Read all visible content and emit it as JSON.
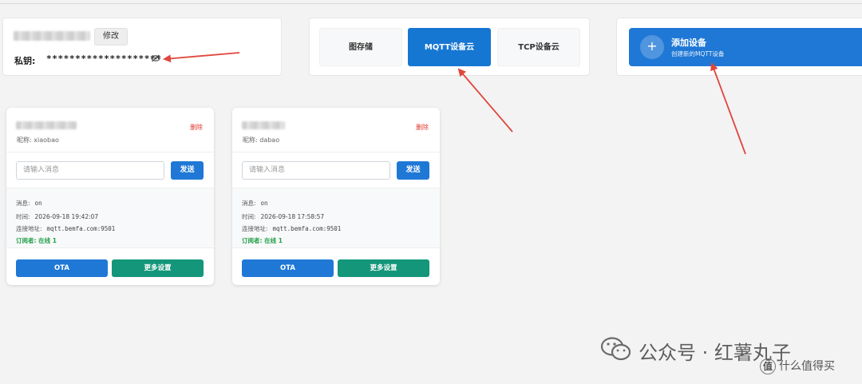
{
  "key_panel": {
    "edit_label": "修改",
    "key_label": "私钥:",
    "key_value": "********************"
  },
  "tabs": [
    {
      "label": "图存储",
      "active": false
    },
    {
      "label": "MQTT设备云",
      "active": true
    },
    {
      "label": "TCP设备云",
      "active": false
    }
  ],
  "add_device": {
    "icon": "+",
    "title": "添加设备",
    "subtitle": "创建新的MQTT设备"
  },
  "devices": [
    {
      "delete_label": "删除",
      "nickname": "昵称: xiaobao",
      "input_placeholder": "请输入消息",
      "send_label": "发送",
      "msg_label": "消息:",
      "msg_value": "on",
      "time_label": "时间:",
      "time_value": "2026-09-18 19:42:07",
      "addr_label": "连接地址:",
      "addr_value": "mqtt.bemfa.com:9501",
      "subscriber": "订阅者: 在线 1",
      "ota_label": "OTA",
      "more_label": "更多设置"
    },
    {
      "delete_label": "删除",
      "nickname": "昵称: dabao",
      "input_placeholder": "请输入消息",
      "send_label": "发送",
      "msg_label": "消息:",
      "msg_value": "on",
      "time_label": "时间:",
      "time_value": "2026-09-18 17:58:57",
      "addr_label": "连接地址:",
      "addr_value": "mqtt.bemfa.com:9501",
      "subscriber": "订阅者: 在线 1",
      "ota_label": "OTA",
      "more_label": "更多设置"
    }
  ],
  "watermark": {
    "text": "公众号 · 红薯丸子",
    "site_badge": "值",
    "site_text": "什么值得买"
  },
  "colors": {
    "primary": "#1f78d6",
    "teal": "#139679",
    "danger": "#e0392f",
    "online": "#23a04b",
    "arrow": "#e0463c"
  }
}
